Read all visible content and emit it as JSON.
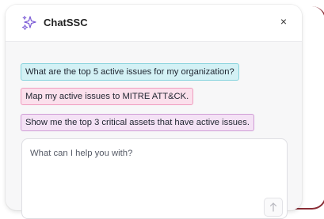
{
  "header": {
    "title": "ChatSSC",
    "logo_icon": "sparkles-icon",
    "close_label": "×"
  },
  "suggestions": [
    {
      "label": "What are the top 5 active issues for my organization?",
      "color": "#d3f1f5"
    },
    {
      "label": "Map my active issues to MITRE ATT&CK.",
      "color": "#fbe0ec"
    },
    {
      "label": "Show me the top 3 critical assets that have active issues.",
      "color": "#f4e2f5"
    }
  ],
  "input": {
    "placeholder": "What can I help you with?",
    "send_icon": "arrow-up-icon"
  },
  "colors": {
    "accent_border": "#8a2d36",
    "logo": "#7b5bd6"
  }
}
